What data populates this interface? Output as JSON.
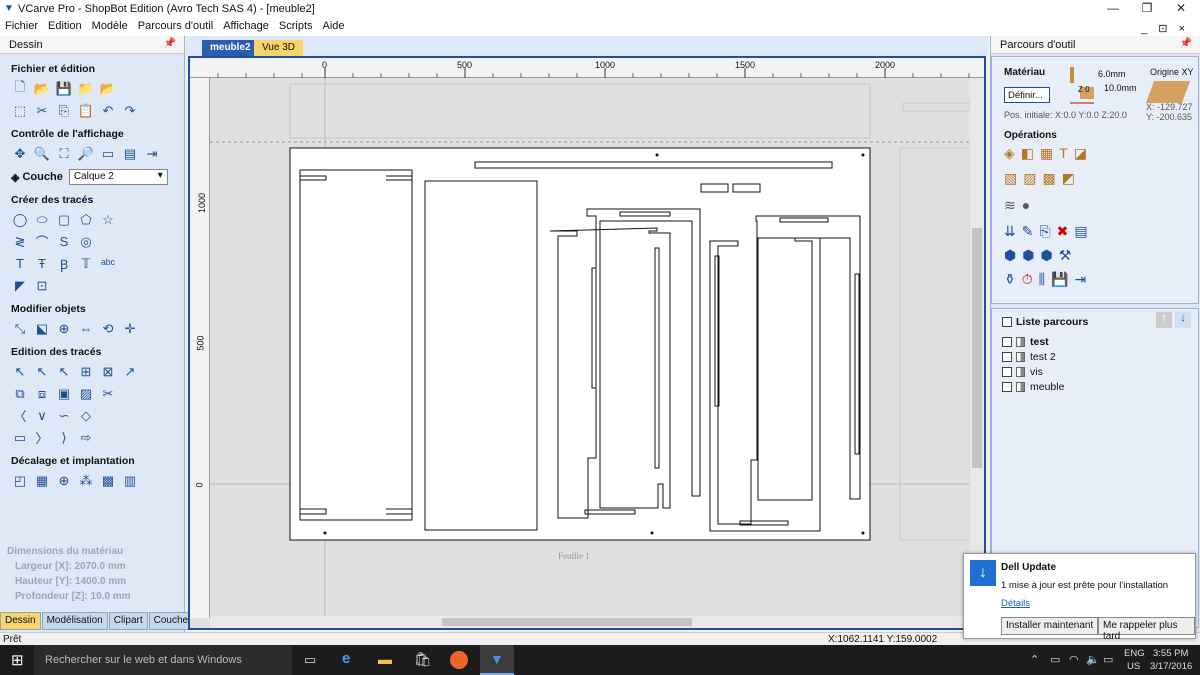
{
  "window": {
    "title": "VCarve Pro - ShopBot Edition (Avro Tech SAS 4) - [meuble2]",
    "minimize": "—",
    "restore": "❐",
    "close": "✕"
  },
  "menu": [
    "Fichier",
    "Edition",
    "Modèle",
    "Parcours d'outil",
    "Affichage",
    "Scripts",
    "Aide"
  ],
  "menu_right": "_ ⊡ ×",
  "left_panel": {
    "title": "Dessin",
    "sections": {
      "file": "Fichier et édition",
      "view": "Contrôle de l'affichage",
      "create": "Créer des tracés",
      "modify": "Modifier objets",
      "edit": "Edition des tracés",
      "offset": "Décalage et implantation"
    },
    "layer_label": "Couche",
    "layer_value": "Calque 2",
    "dims_title": "Dimensions du matériau",
    "width": "Largeur  [X]: 2070.0 mm",
    "height": "Hauteur  [Y]: 1400.0 mm",
    "depth": "Profondeur [Z]: 10.0 mm",
    "tabs": [
      "Dessin",
      "Modélisation",
      "Clipart",
      "Couches"
    ]
  },
  "doc_tabs": [
    "meuble2",
    "Vue 3D"
  ],
  "ruler": {
    "h_labels": [
      "0",
      "500",
      "1000",
      "1500",
      "2000"
    ],
    "v_labels": [
      "1000",
      "500",
      "0"
    ]
  },
  "sheet_label": "Feuille 1",
  "right_panel": {
    "title": "Parcours d'outil",
    "material": "Matériau",
    "define_button": "Définir...",
    "thickness_top": "6.0mm",
    "thickness": "10.0mm",
    "z0": "Z 0",
    "origin": "Origine XY",
    "pos": "Pos. initiale: X:0.0 Y:0.0 Z:20.0",
    "origin_x": "X: -129.727",
    "origin_y": "Y: -200.635",
    "operations": "Opérations",
    "list_title": "Liste parcours",
    "toolpaths": [
      "test",
      "test 2",
      "vis",
      "meuble"
    ]
  },
  "status": {
    "left": "Prêt",
    "coords": "X:1062.1141 Y:159.0002"
  },
  "notification": {
    "title": "Dell Update",
    "message": "1 mise à jour est prête pour l'installation",
    "link": "Détails",
    "btn1": "Installer maintenant",
    "btn2": "Me rappeler plus tard"
  },
  "taskbar": {
    "search": "Rechercher sur le web et dans Windows",
    "lang": "ENG",
    "region": "US",
    "time": "3:55 PM",
    "date": "3/17/2016"
  },
  "colors": {
    "accent": "#1f4fa0",
    "panel": "#dfe8f6",
    "tab_active": "#f8d46b"
  }
}
